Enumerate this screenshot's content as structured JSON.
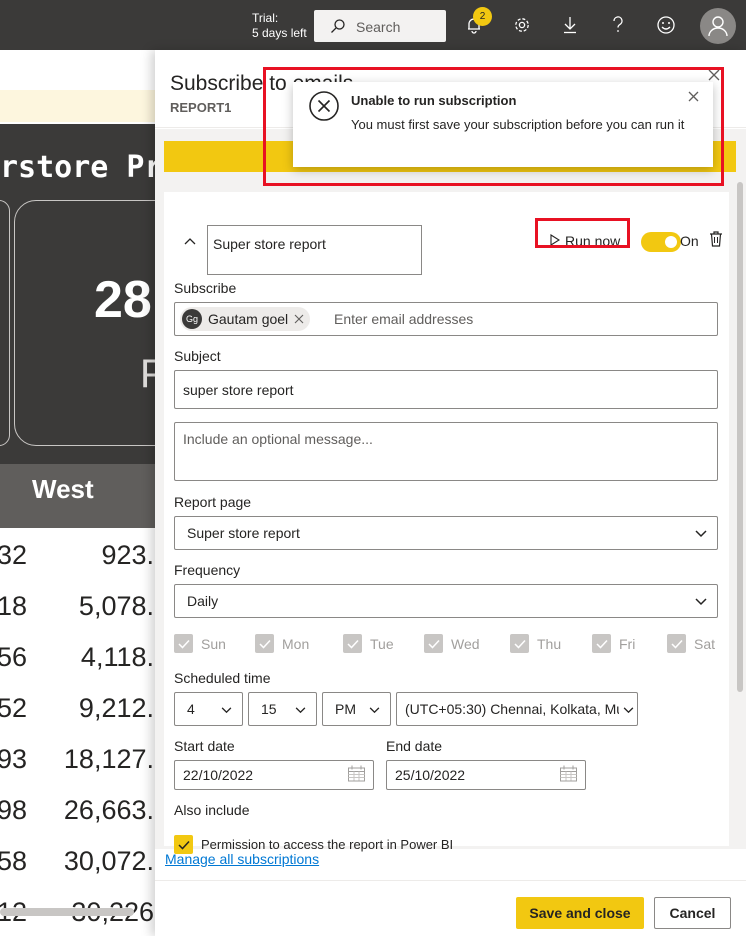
{
  "topbar": {
    "trial_line1": "Trial:",
    "trial_line2": "5 days left",
    "search_placeholder": "Search",
    "notification_count": "2",
    "icons": [
      "search-icon",
      "bell-icon",
      "gear-icon",
      "download-icon",
      "help-icon",
      "smiley-icon",
      "user-avatar-icon"
    ]
  },
  "background_report": {
    "title_fragment": "rstore Pro",
    "big_number": "28",
    "sub_letter": "P",
    "column_header": "West",
    "rows": [
      {
        "left": "32",
        "right": "923."
      },
      {
        "left": "18",
        "right": "5,078."
      },
      {
        "left": "56",
        "right": "4,118."
      },
      {
        "left": "52",
        "right": "9,212."
      },
      {
        "left": "93",
        "right": "18,127."
      },
      {
        "left": "98",
        "right": "26,663."
      },
      {
        "left": "58",
        "right": "30,072."
      },
      {
        "left": "12",
        "right": "30,226"
      }
    ]
  },
  "panel": {
    "title": "Subscribe to emails",
    "subtitle": "REPORT1",
    "subscription_name": "Super store report",
    "run_now_label": "Run now",
    "toggle_label": "On",
    "subscribe_label": "Subscribe",
    "subscriber_initials": "Gg",
    "subscriber_name": "Gautam goel",
    "email_placeholder": "Enter email addresses",
    "subject_label": "Subject",
    "subject_value": "super store report",
    "message_placeholder": "Include an optional message...",
    "report_page_label": "Report page",
    "report_page_value": "Super store report",
    "frequency_label": "Frequency",
    "frequency_value": "Daily",
    "days": [
      "Sun",
      "Mon",
      "Tue",
      "Wed",
      "Thu",
      "Fri",
      "Sat"
    ],
    "scheduled_time_label": "Scheduled time",
    "hour_value": "4",
    "minute_value": "15",
    "ampm_value": "PM",
    "timezone_value": "(UTC+05:30) Chennai, Kolkata, Mu",
    "start_date_label": "Start date",
    "start_date_value": "22/10/2022",
    "end_date_label": "End date",
    "end_date_value": "25/10/2022",
    "also_include_label": "Also include",
    "permission_label": "Permission to access the report in Power BI",
    "manage_link": "Manage all subscriptions",
    "save_button": "Save and close",
    "cancel_button": "Cancel"
  },
  "toast": {
    "title": "Unable to run subscription",
    "message": "You must first save your subscription before you can run it"
  },
  "colors": {
    "accent": "#f2c811",
    "topbar": "#3b3a39",
    "highlight": "#e81123",
    "link": "#0078d4"
  }
}
